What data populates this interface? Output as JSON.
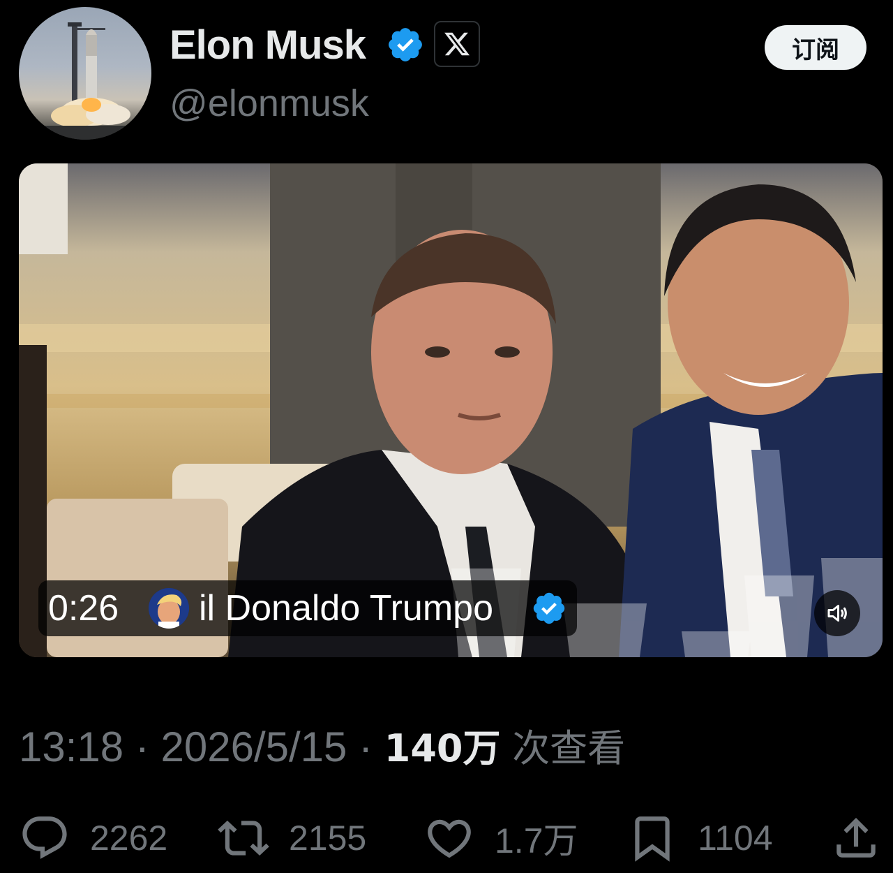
{
  "header": {
    "display_name": "Elon Musk",
    "handle": "@elonmusk",
    "subscribe_label": "订阅",
    "affiliate_icon": "x-logo-icon",
    "verified_icon": "verified-badge-icon"
  },
  "video": {
    "time": "0:26",
    "account_name": "il Donaldo Trumpo",
    "volume_icon": "speaker-icon"
  },
  "meta": {
    "time": "13:18",
    "date": "2026/5/15",
    "views_count": "140万",
    "views_label": "次查看"
  },
  "actions": {
    "replies": "2262",
    "reposts": "2155",
    "likes": "1.7万",
    "bookmarks": "1104"
  },
  "colors": {
    "background": "#000000",
    "text": "#e7e9ea",
    "muted": "#71767b",
    "verified": "#1d9bf0"
  }
}
